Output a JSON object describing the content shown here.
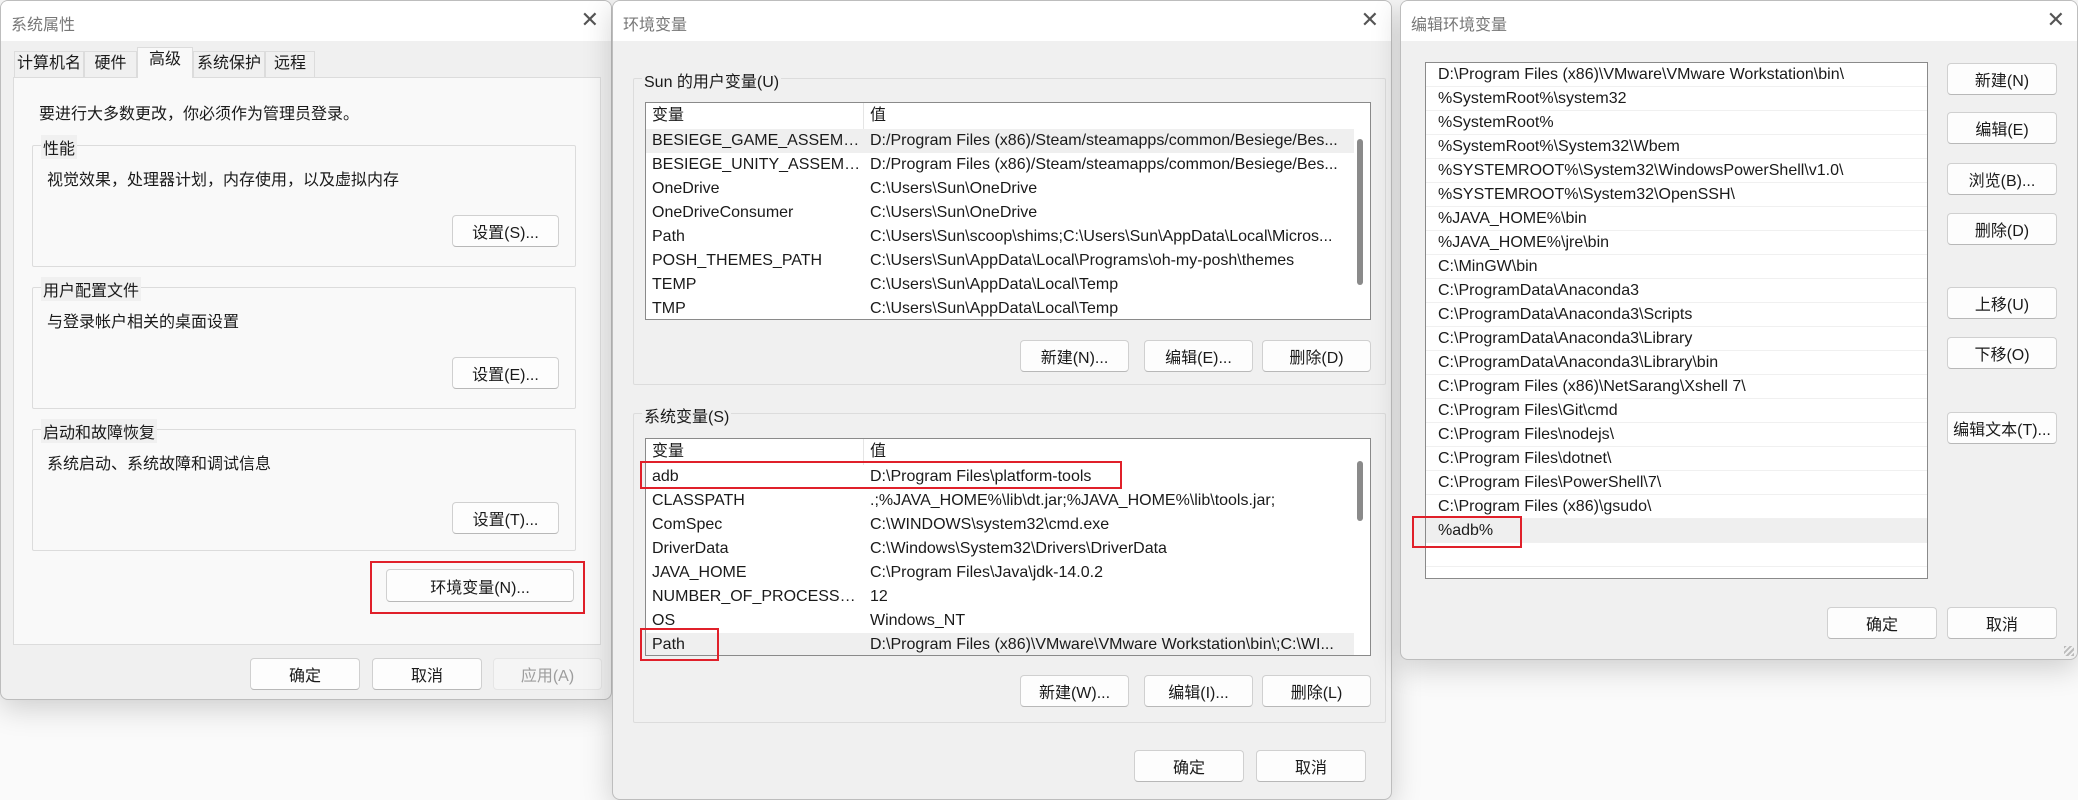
{
  "sys_props": {
    "title": "系统属性",
    "tabs": [
      "计算机名",
      "硬件",
      "高级",
      "系统保护",
      "远程"
    ],
    "active_tab": "高级",
    "admin_note": "要进行大多数更改，你必须作为管理员登录。",
    "performance": {
      "label": "性能",
      "desc": "视觉效果，处理器计划，内存使用，以及虚拟内存",
      "button": "设置(S)..."
    },
    "user_profiles": {
      "label": "用户配置文件",
      "desc": "与登录帐户相关的桌面设置",
      "button": "设置(E)..."
    },
    "startup": {
      "label": "启动和故障恢复",
      "desc": "系统启动、系统故障和调试信息",
      "button": "设置(T)..."
    },
    "env_button": "环境变量(N)...",
    "ok": "确定",
    "cancel": "取消",
    "apply": "应用(A)"
  },
  "env_vars": {
    "title": "环境变量",
    "user_group": "Sun 的用户变量(U)",
    "col_var": "变量",
    "col_val": "值",
    "user_rows": [
      [
        "BESIEGE_GAME_ASSEMBLIES",
        "D:/Program Files (x86)/Steam/steamapps/common/Besiege/Bes..."
      ],
      [
        "BESIEGE_UNITY_ASSEMBLIES",
        "D:/Program Files (x86)/Steam/steamapps/common/Besiege/Bes..."
      ],
      [
        "OneDrive",
        "C:\\Users\\Sun\\OneDrive"
      ],
      [
        "OneDriveConsumer",
        "C:\\Users\\Sun\\OneDrive"
      ],
      [
        "Path",
        "C:\\Users\\Sun\\scoop\\shims;C:\\Users\\Sun\\AppData\\Local\\Micros..."
      ],
      [
        "POSH_THEMES_PATH",
        "C:\\Users\\Sun\\AppData\\Local\\Programs\\oh-my-posh\\themes"
      ],
      [
        "TEMP",
        "C:\\Users\\Sun\\AppData\\Local\\Temp"
      ],
      [
        "TMP",
        "C:\\Users\\Sun\\AppData\\Local\\Temp"
      ]
    ],
    "user_buttons": {
      "new": "新建(N)...",
      "edit": "编辑(E)...",
      "delete": "删除(D)"
    },
    "system_group": "系统变量(S)",
    "system_rows": [
      [
        "adb",
        "D:\\Program Files\\platform-tools"
      ],
      [
        "CLASSPATH",
        ".;%JAVA_HOME%\\lib\\dt.jar;%JAVA_HOME%\\lib\\tools.jar;"
      ],
      [
        "ComSpec",
        "C:\\WINDOWS\\system32\\cmd.exe"
      ],
      [
        "DriverData",
        "C:\\Windows\\System32\\Drivers\\DriverData"
      ],
      [
        "JAVA_HOME",
        "C:\\Program Files\\Java\\jdk-14.0.2"
      ],
      [
        "NUMBER_OF_PROCESSORS",
        "12"
      ],
      [
        "OS",
        "Windows_NT"
      ],
      [
        "Path",
        "D:\\Program Files (x86)\\VMware\\VMware Workstation\\bin\\;C:\\WI..."
      ]
    ],
    "system_buttons": {
      "new": "新建(W)...",
      "edit": "编辑(I)...",
      "delete": "删除(L)"
    },
    "ok": "确定",
    "cancel": "取消"
  },
  "edit_env": {
    "title": "编辑环境变量",
    "entries": [
      "D:\\Program Files (x86)\\VMware\\VMware Workstation\\bin\\",
      "%SystemRoot%\\system32",
      "%SystemRoot%",
      "%SystemRoot%\\System32\\Wbem",
      "%SYSTEMROOT%\\System32\\WindowsPowerShell\\v1.0\\",
      "%SYSTEMROOT%\\System32\\OpenSSH\\",
      "%JAVA_HOME%\\bin",
      "%JAVA_HOME%\\jre\\bin",
      "C:\\MinGW\\bin",
      "C:\\ProgramData\\Anaconda3",
      "C:\\ProgramData\\Anaconda3\\Scripts",
      "C:\\ProgramData\\Anaconda3\\Library",
      "C:\\ProgramData\\Anaconda3\\Library\\bin",
      "C:\\Program Files (x86)\\NetSarang\\Xshell 7\\",
      "C:\\Program Files\\Git\\cmd",
      "C:\\Program Files\\nodejs\\",
      "C:\\Program Files\\dotnet\\",
      "C:\\Program Files\\PowerShell\\7\\",
      "C:\\Program Files (x86)\\gsudo\\",
      "%adb%"
    ],
    "selected_entry": "%adb%",
    "buttons": {
      "new": "新建(N)",
      "edit": "编辑(E)",
      "browse": "浏览(B)...",
      "delete": "删除(D)",
      "up": "上移(U)",
      "down": "下移(O)",
      "edit_text": "编辑文本(T)..."
    },
    "ok": "确定",
    "cancel": "取消"
  },
  "highlight_color": "#e0202a"
}
